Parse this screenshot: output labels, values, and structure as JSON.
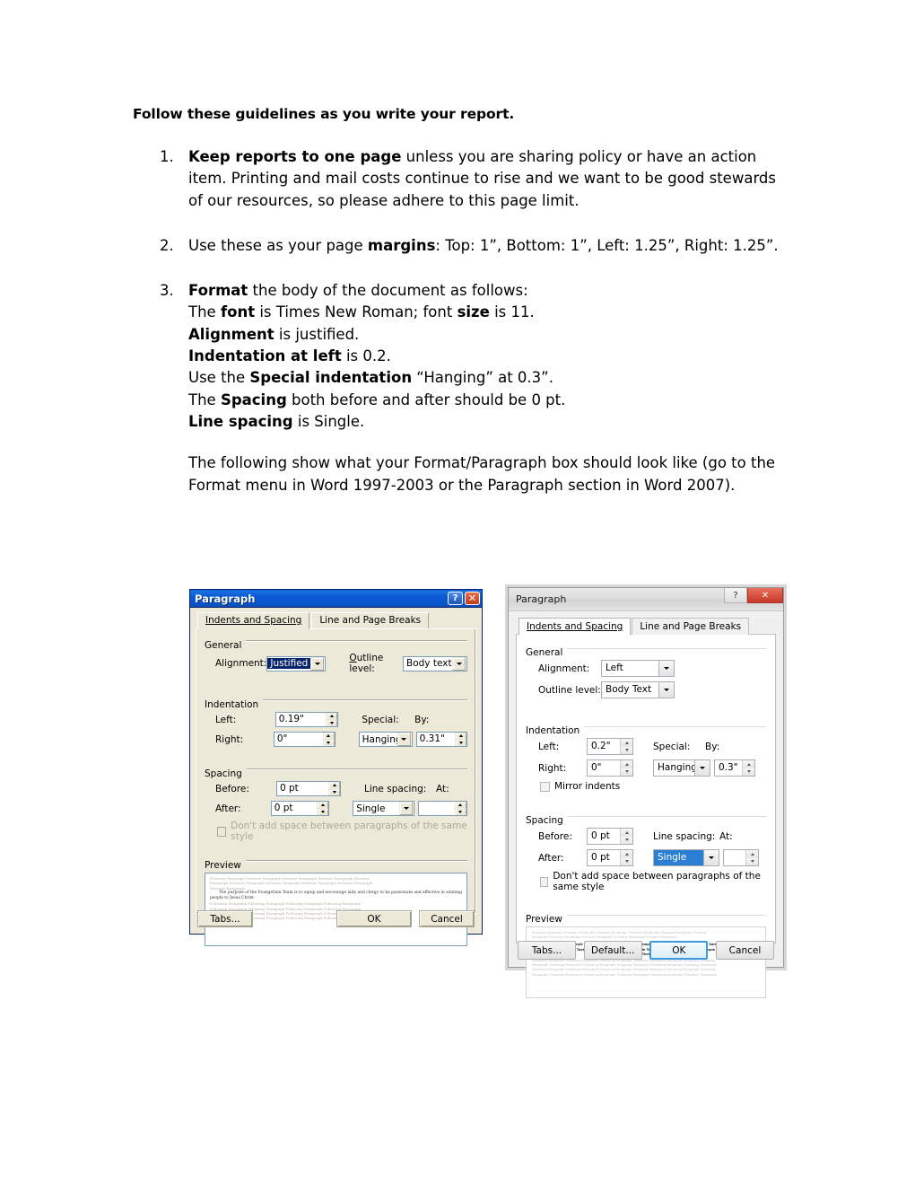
{
  "document": {
    "title": "Follow these guidelines as you write your report.",
    "items": [
      {
        "num": "1.",
        "bold_lead": "Keep reports to one page",
        "rest": " unless you are sharing policy or have an action item. Printing and mail costs continue to rise and we want to be good stewards of our resources, so please adhere to this page limit."
      },
      {
        "num": "2.",
        "pre": "Use these as your page ",
        "bold_lead": "margins",
        "rest": ": Top: 1”, Bottom: 1”, Left: 1.25”, Right: 1.25”."
      },
      {
        "num": "3.",
        "bold_lead": "Format",
        "rest": " the body of the document as follows:",
        "lines": [
          {
            "pre": "The ",
            "b1": "font",
            "mid": " is Times New Roman; font ",
            "b2": "size",
            "post": " is 11."
          },
          {
            "pre": "",
            "b1": "Alignment",
            "mid": " is justified.",
            "b2": "",
            "post": ""
          },
          {
            "pre": "",
            "b1": "Indentation at left",
            "mid": " is 0.2.",
            "b2": "",
            "post": ""
          },
          {
            "pre": "Use the ",
            "b1": "Special indentation",
            "mid": " “Hanging” at 0.3”.",
            "b2": "",
            "post": ""
          },
          {
            "pre": "The ",
            "b1": "Spacing",
            "mid": " both before and after should be 0 pt.",
            "b2": "",
            "post": ""
          },
          {
            "pre": "",
            "b1": "Line spacing",
            "mid": " is Single.",
            "b2": "",
            "post": ""
          }
        ]
      }
    ],
    "closing": "The following show what your Format/Paragraph box should look like (go to the Format menu in Word 1997-2003 or the Paragraph section in Word 2007)."
  },
  "dialog_xp": {
    "title": "Paragraph",
    "help_glyph": "?",
    "close_glyph": "✕",
    "tabs": [
      {
        "label": "Indents and Spacing",
        "active": true
      },
      {
        "label": "Line and Page Breaks",
        "active": false
      }
    ],
    "general": {
      "legend": "General",
      "alignment_label": "Alignment:",
      "alignment_value": "Justified",
      "outline_label": "Outline level:",
      "outline_value": "Body text"
    },
    "indentation": {
      "legend": "Indentation",
      "left_label": "Left:",
      "left_value": "0.19\"",
      "right_label": "Right:",
      "right_value": "0\"",
      "special_label": "Special:",
      "special_value": "Hanging",
      "by_label": "By:",
      "by_value": "0.31\""
    },
    "spacing": {
      "legend": "Spacing",
      "before_label": "Before:",
      "before_value": "0 pt",
      "after_label": "After:",
      "after_value": "0 pt",
      "line_spacing_label": "Line spacing:",
      "line_spacing_value": "Single",
      "at_label": "At:",
      "at_value": "",
      "dont_add_space": "Don't add space between paragraphs of the same style"
    },
    "preview": {
      "legend": "Preview",
      "previous_line": "Previous Paragraph Previous Paragraph Previous Paragraph Previous Paragraph Previous",
      "previous_line2": "Paragraph Previous Paragraph Previous Paragraph Previous Paragraph Previous Paragraph",
      "previous_line3": "Previous Paragraph",
      "body": "The purpose of the Evangelism Team is to equip and encourage laity and clergy to be passionate and effective in winning people to Jesus Christ.",
      "following_line": "Following Paragraph Following Paragraph Following Paragraph Following Paragraph"
    },
    "buttons": {
      "tabs": "Tabs...",
      "ok": "OK",
      "cancel": "Cancel"
    }
  },
  "dialog_w7": {
    "title": "Paragraph",
    "help_glyph": "?",
    "close_glyph": "✕",
    "tabs": [
      {
        "label": "Indents and Spacing",
        "active": true
      },
      {
        "label": "Line and Page Breaks",
        "active": false
      }
    ],
    "general": {
      "legend": "General",
      "alignment_label": "Alignment:",
      "alignment_value": "Left",
      "outline_label": "Outline level:",
      "outline_value": "Body Text"
    },
    "indentation": {
      "legend": "Indentation",
      "left_label": "Left:",
      "left_value": "0.2\"",
      "right_label": "Right:",
      "right_value": "0\"",
      "special_label": "Special:",
      "special_value": "Hanging",
      "by_label": "By:",
      "by_value": "0.3\"",
      "mirror_indents": "Mirror indents"
    },
    "spacing": {
      "legend": "Spacing",
      "before_label": "Before:",
      "before_value": "0 pt",
      "after_label": "After:",
      "after_value": "0 pt",
      "line_spacing_label": "Line spacing:",
      "line_spacing_value": "Single",
      "at_label": "At:",
      "at_value": "",
      "dont_add_space": "Don't add space between paragraphs of the same style"
    },
    "preview": {
      "legend": "Preview",
      "previous_line": "Previous Paragraph Previous Paragraph Previous Paragraph Previous Paragraph Previous Paragraph Previous",
      "previous_line2": "Paragraph Previous Paragraph Previous Paragraph Previous Paragraph Previous Paragraph",
      "sample_line": "Sample Text Sample Text Sample Text Sample Text Sample Text Sample Text Sample Text Sample Text Sample",
      "sample_line2": "Text Sample Text Sample Text Sample Text Sample Text Sample Text Sample Text Sample Text Sample",
      "sample_line3": "Text Sample Text Sample Text Sample Text Sample Text",
      "following_line": "Following Paragraph Following Paragraph Following Paragraph Following Paragraph Following Paragraph Following",
      "following_line2": "Paragraph Following Paragraph Following Paragraph Following Paragraph Following Paragraph Following Paragraph"
    },
    "buttons": {
      "tabs": "Tabs...",
      "default": "Default...",
      "ok": "OK",
      "cancel": "Cancel"
    }
  }
}
